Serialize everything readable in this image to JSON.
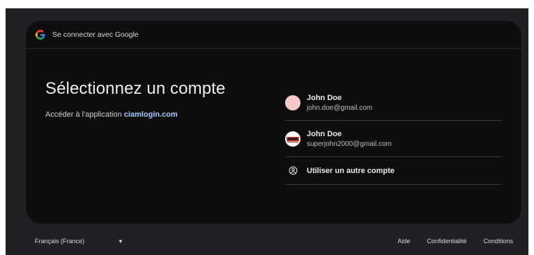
{
  "header": {
    "title": "Se connecter avec Google",
    "logo_icon": "google-g-icon"
  },
  "main": {
    "title": "Sélectionnez un compte",
    "subtitle_prefix": "Accéder à l'application ",
    "app_name": "ciamlogin.com"
  },
  "accounts": [
    {
      "name": "John Doe",
      "email": "john.doe@gmail.com",
      "avatar_color": "#f3c9c9"
    },
    {
      "name": "John Doe",
      "email": "superjohn2000@gmail.com",
      "avatar_icon": "logo-avatar"
    }
  ],
  "other_account": {
    "label": "Utiliser un autre compte",
    "icon": "account-circle-icon"
  },
  "footer": {
    "language": "Français (France)",
    "links": [
      "Aide",
      "Confidentialité",
      "Conditions"
    ]
  },
  "colors": {
    "card_bg": "#0e0e0e",
    "link": "#a8c7fa"
  }
}
